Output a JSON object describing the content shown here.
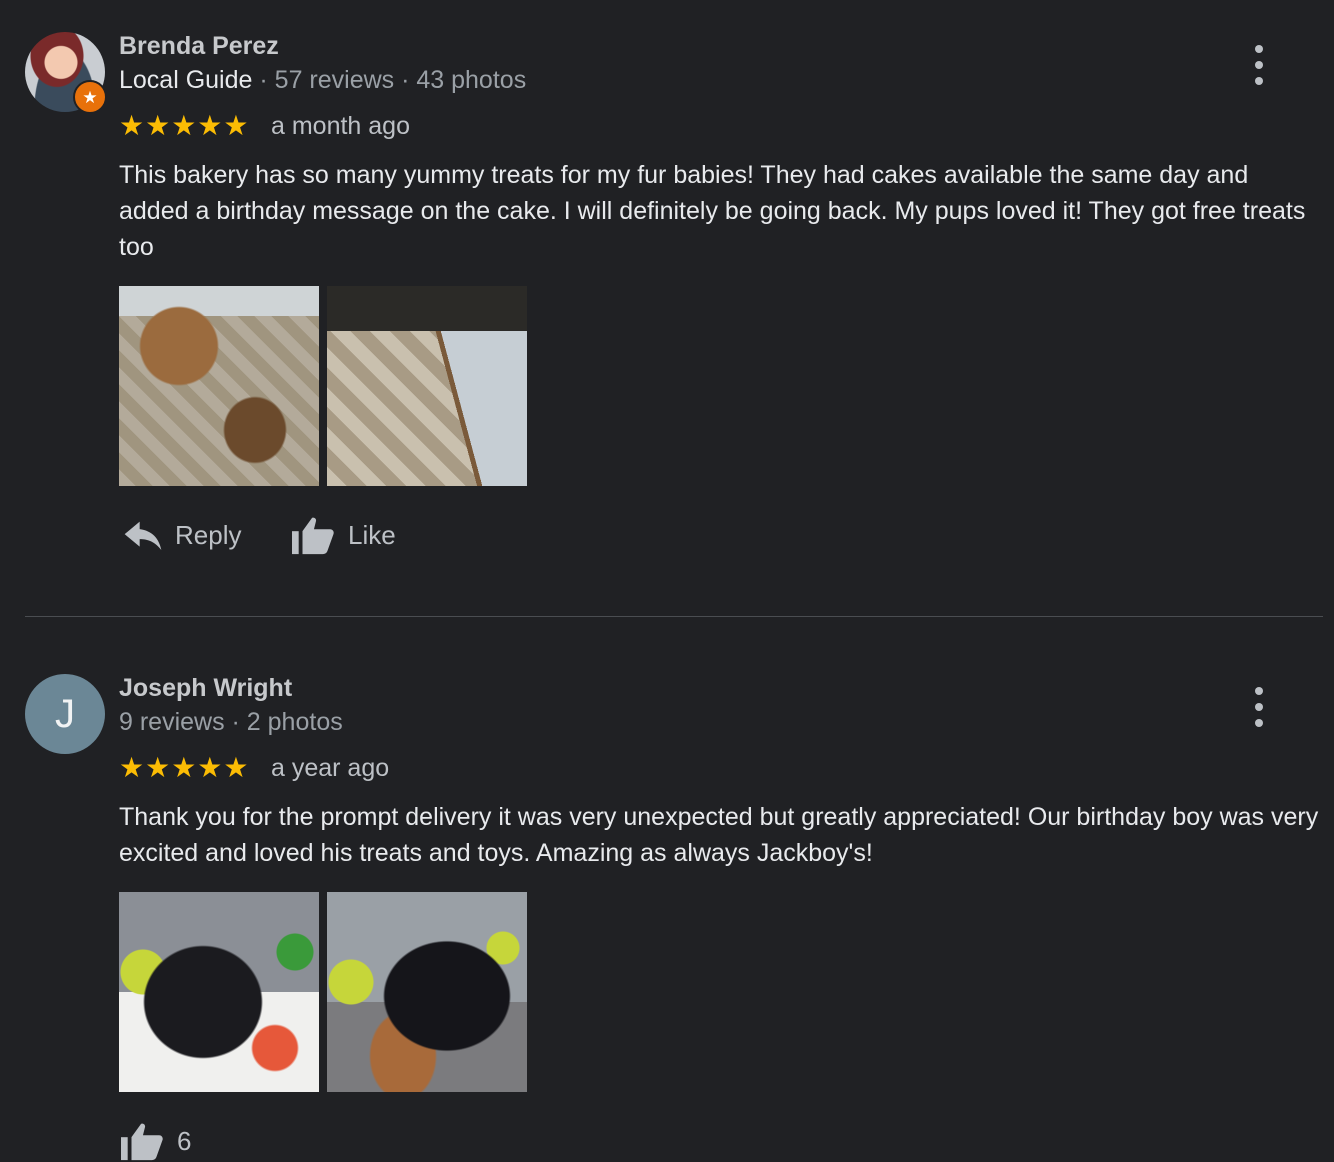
{
  "reviews": [
    {
      "author": "Brenda Perez",
      "badge": "Local Guide",
      "stats": "· 57 reviews · 43 photos",
      "stars": "★★★★★",
      "time": "a month ago",
      "text": "This bakery has so many yummy treats for my fur babies! They had cakes available the same day and added a birthday message on the cake. I will definitely be going back. My pups loved it! They got free treats too",
      "reply_label": "Reply",
      "like_label": "Like",
      "rating": 5,
      "icons": [
        "more-options-icon",
        "reply-icon",
        "thumbs-up-icon",
        "local-guide-star-icon"
      ]
    },
    {
      "author": "Joseph Wright",
      "avatar_letter": "J",
      "stats": "9 reviews · 2 photos",
      "stars": "★★★★★",
      "time": "a year ago",
      "text": "Thank you for the prompt delivery it was very unexpected but greatly appreciated! Our birthday boy was very excited and loved his treats and toys. Amazing as always Jackboy's!",
      "like_count": "6",
      "rating": 5,
      "icons": [
        "more-options-icon",
        "thumbs-up-icon"
      ]
    }
  ],
  "colors": {
    "background": "#202124",
    "star": "#fbbc04",
    "badge": "#e8710a",
    "avatar_bg": "#6b8796"
  }
}
